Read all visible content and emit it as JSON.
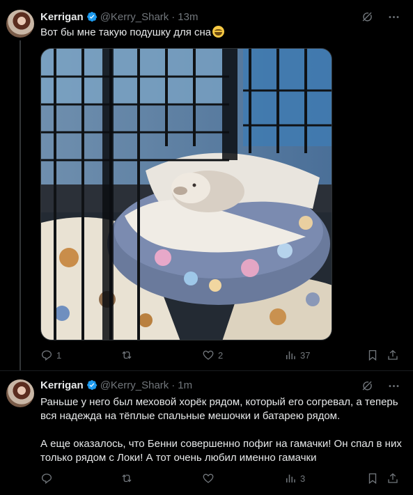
{
  "tweets": [
    {
      "author": {
        "name": "Kerrigan",
        "handle": "@Kerry_Shark",
        "verified": true
      },
      "separator": "·",
      "time": "13m",
      "text_lines": [
        "Вот бы мне такую подушку для сна"
      ],
      "emoji": "grinning-face",
      "media": {
        "description_icon": "photo",
        "accent": "#8fa6c4"
      },
      "stats": {
        "replies": "1",
        "reposts": "",
        "likes": "2",
        "views": "37"
      }
    },
    {
      "author": {
        "name": "Kerrigan",
        "handle": "@Kerry_Shark",
        "verified": true
      },
      "separator": "·",
      "time": "1m",
      "paragraphs": [
        "Раньше у него был меховой хорёк рядом, который его согревал, а теперь вся надежда на тёплые спальные мешочки и батарею рядом.",
        "А еще оказалось, что Бенни совершенно пофиг на гамачки! Он спал в них только рядом с Локи! А тот очень любил именно гамачки"
      ],
      "stats": {
        "replies": "",
        "reposts": "",
        "likes": "",
        "views": "3"
      }
    }
  ],
  "colors": {
    "background": "#000000",
    "text": "#e7e9ea",
    "muted": "#71767b",
    "verified": "#1d9bf0"
  }
}
